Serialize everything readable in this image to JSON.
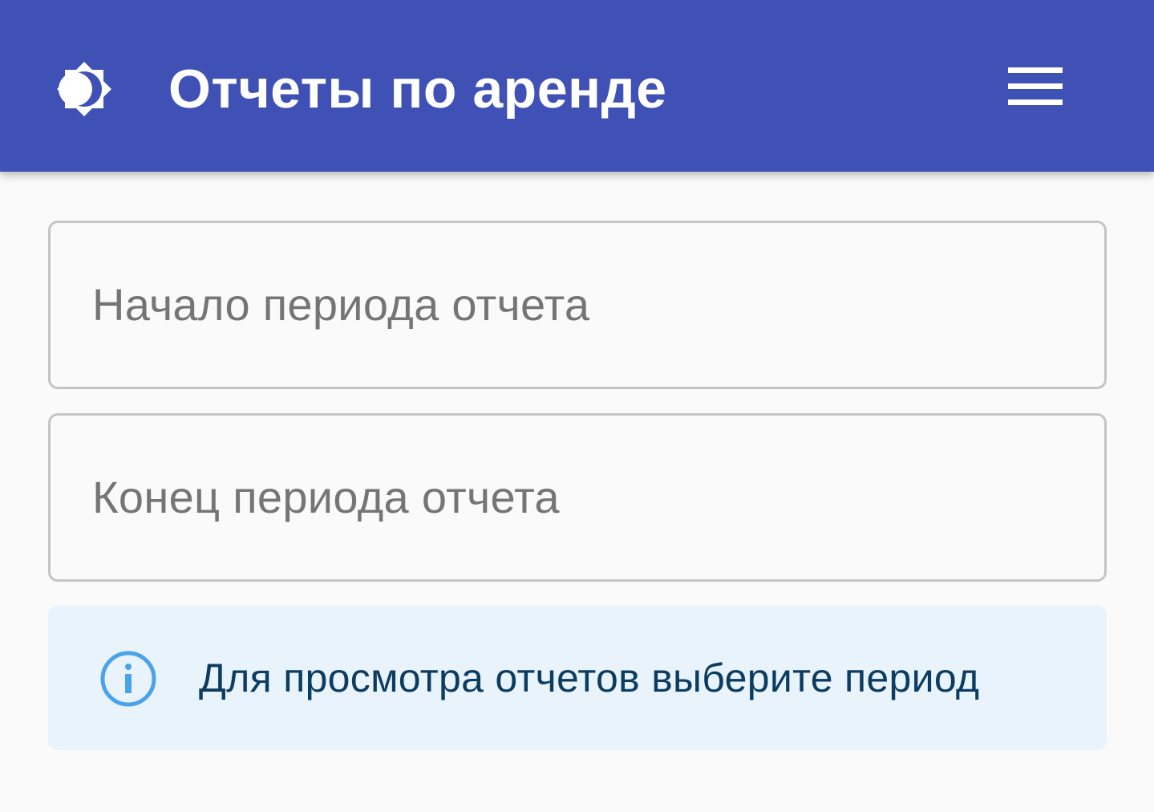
{
  "app_bar": {
    "title": "Отчеты по аренде",
    "background_color": "#3f51b5",
    "theme_toggle_icon": "brightness-icon",
    "menu_icon": "hamburger-menu-icon"
  },
  "form": {
    "start_date": {
      "placeholder": "Начало периода отчета",
      "value": ""
    },
    "end_date": {
      "placeholder": "Конец периода отчета",
      "value": ""
    }
  },
  "alert": {
    "icon": "info-icon",
    "text": "Для просмотра отчетов выберите период",
    "background_color": "#e8f3fc",
    "icon_color": "#4aa3e8",
    "text_color": "#0d3c61"
  }
}
